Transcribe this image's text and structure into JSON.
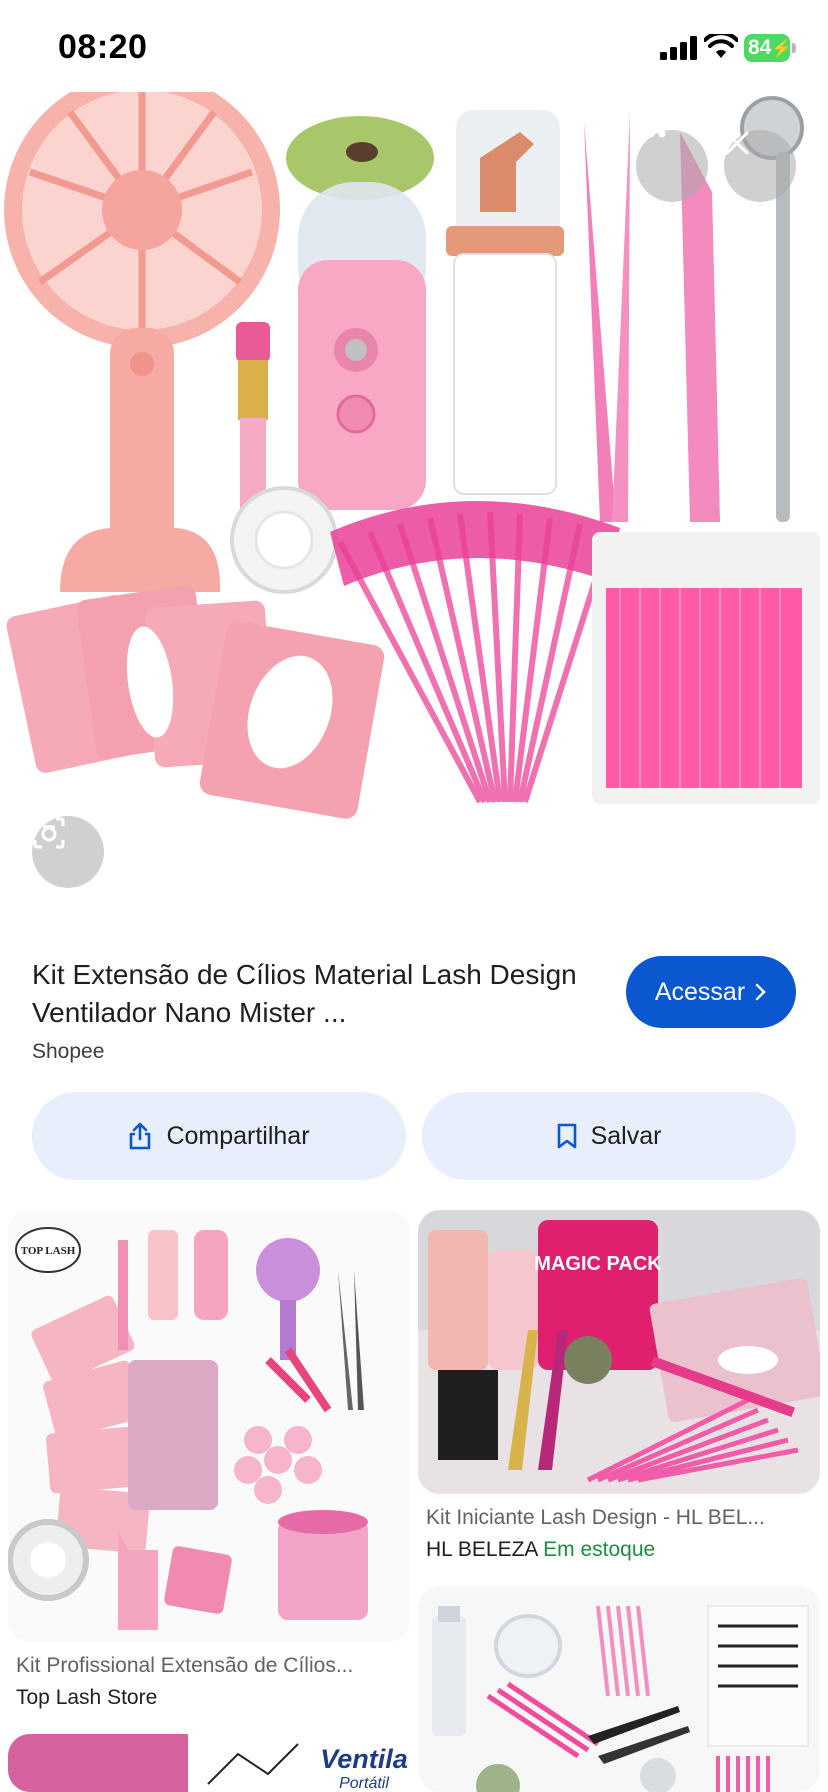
{
  "status_bar": {
    "time": "08:20",
    "battery": "84"
  },
  "hero": {
    "icons": [
      "more-icon",
      "close-icon",
      "google-lens-icon"
    ]
  },
  "result": {
    "title": "Kit Extensão de Cílios Material Lash Design Ventilador Nano Mister ...",
    "source": "Shopee",
    "visit_label": "Acessar",
    "share_label": "Compartilhar",
    "save_label": "Salvar"
  },
  "related": [
    {
      "title": "Kit Profissional Extensão de Cílios...",
      "store": "Top Lash Store",
      "logo_text": "TOP LASH"
    },
    {
      "title": "Kit Iniciante Lash Design - HL BEL...",
      "store": "HL BELEZA",
      "stock": "Em estoque",
      "pack_text": "MAGIC PACK"
    },
    {
      "title": "",
      "store": ""
    },
    {
      "banner_text": "Ventila",
      "banner_sub": "Portátil"
    }
  ],
  "colors": {
    "accent_blue": "#0b57d0",
    "pill_bg": "#e8eefc",
    "stock_green": "#1e8e3e",
    "product_pink": "#f4a7b9",
    "hot_pink": "#ff4fa0"
  }
}
